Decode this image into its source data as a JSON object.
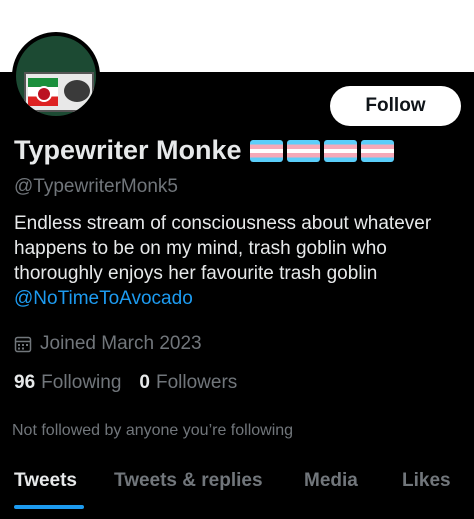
{
  "profile": {
    "display_name": "Typewriter Monke",
    "handle": "@TypewriterMonk5",
    "bio_text": "Endless stream of consciousness about whatever happens to be on my mind, trash goblin who thoroughly enjoys her favourite trash goblin ",
    "bio_mention": "@NoTimeToAvocado",
    "joined": "Joined March 2023",
    "name_flag_icons": [
      "transgender-flag",
      "transgender-flag",
      "transgender-flag",
      "transgender-flag"
    ]
  },
  "actions": {
    "follow_label": "Follow"
  },
  "stats": {
    "following_count": "96",
    "following_label": "Following",
    "followers_count": "0",
    "followers_label": "Followers"
  },
  "social_context": "Not followed by anyone you’re following",
  "tabs": [
    {
      "label": "Tweets",
      "active": true
    },
    {
      "label": "Tweets & replies",
      "active": false
    },
    {
      "label": "Media",
      "active": false
    },
    {
      "label": "Likes",
      "active": false
    }
  ],
  "colors": {
    "background": "#000000",
    "accent": "#1d9bf0",
    "text_primary": "#e7e9ea",
    "text_secondary": "#71767b"
  }
}
